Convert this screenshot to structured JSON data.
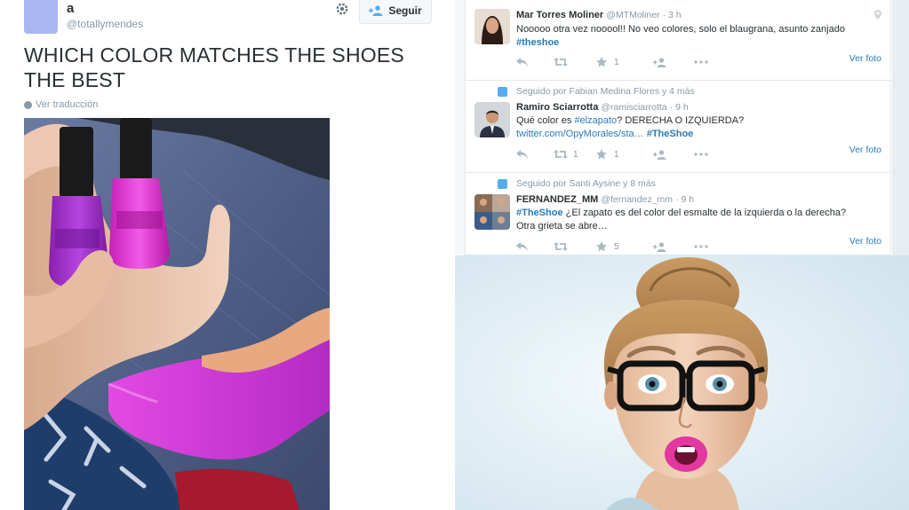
{
  "left_tweet": {
    "user_name": "a",
    "user_handle": "@totallymendes",
    "follow_label": "Seguir",
    "text": "WHICH COLOR MATCHES THE SHOES THE BEST",
    "translate_label": "Ver traducción",
    "photo_icon": "nail-polish-and-shoe-photo"
  },
  "feed": {
    "tweets": [
      {
        "context": "",
        "name": "Mar Torres Moliner",
        "handle": "@MTMoliner",
        "time": "· 3 h",
        "body_1": "Nooooo otra vez nooool!! No veo colores, solo el blaugrana, asunto zanjado",
        "hashtag_1": "#theshoe",
        "retweets": "",
        "favorites": "1",
        "ver_foto": "Ver foto"
      },
      {
        "context": "Seguido por Fabian Medina Flores y 4 más",
        "name": "Ramiro Sciarrotta",
        "handle": "@ramisciarrotta",
        "time": "· 9 h",
        "body_1a": "Qué color es ",
        "hashtag_1": "#elzapato",
        "body_1b": "? DERECHA O IZQUIERDA?",
        "link": "twitter.com/OpyMorales/sta…",
        "hashtag_2": "#TheShoe",
        "retweets": "1",
        "favorites": "1",
        "ver_foto": "Ver foto"
      },
      {
        "context": "Seguido por Santi Aysine y 8 más",
        "name": "FERNANDEZ_MM",
        "handle": "@fernandez_mm",
        "time": "· 9 h",
        "hashtag_1": "#TheShoe",
        "body_1": " ¿El zapato es del color del esmalte de la izquierda o la derecha?",
        "body_2": "Otra grieta se abre…",
        "retweets": "",
        "favorites": "5",
        "ver_foto": "Ver foto"
      }
    ]
  },
  "woman_photo": {
    "icon": "surprised-woman-with-glasses-photo"
  },
  "colors": {
    "link_blue": "#2b7bb9",
    "muted_gray": "#8899a6",
    "polish_purple": "#a52fd0",
    "polish_pink": "#e63ed6",
    "shoe_magenta": "#c83ad6"
  }
}
